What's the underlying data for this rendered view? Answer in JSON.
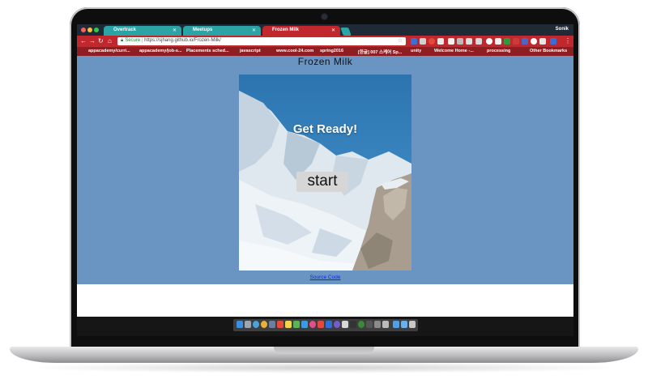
{
  "browser": {
    "tabs": [
      {
        "label": "Overtrack"
      },
      {
        "label": "Meetups"
      },
      {
        "label": "Frozen Milk"
      }
    ],
    "profile_name": "Sonik",
    "address": {
      "secure_label": "Secure",
      "url": "https://sjhang.github.io/Frozen-Milk/"
    },
    "bookmarks": [
      {
        "label": "appacademy/curri..."
      },
      {
        "label": "appacademy/job-s..."
      },
      {
        "label": "Placements sched..."
      },
      {
        "label": "javascript"
      },
      {
        "label": "www.cool-24.com"
      },
      {
        "label": "spring2016"
      },
      {
        "label": "[한글] 007 스케어 Sp..."
      },
      {
        "label": "unity"
      },
      {
        "label": "Welcome Home -..."
      },
      {
        "label": "processing"
      },
      {
        "label": "Other Bookmarks"
      }
    ]
  },
  "page": {
    "title": "Frozen Milk",
    "game": {
      "heading": "Get Ready!",
      "start_label": "start"
    },
    "source_link": "Source Code"
  },
  "colors": {
    "page_background": "#6a94c2",
    "toolbar": "#c0282e",
    "tab_inactive": "#2aa4a4"
  }
}
